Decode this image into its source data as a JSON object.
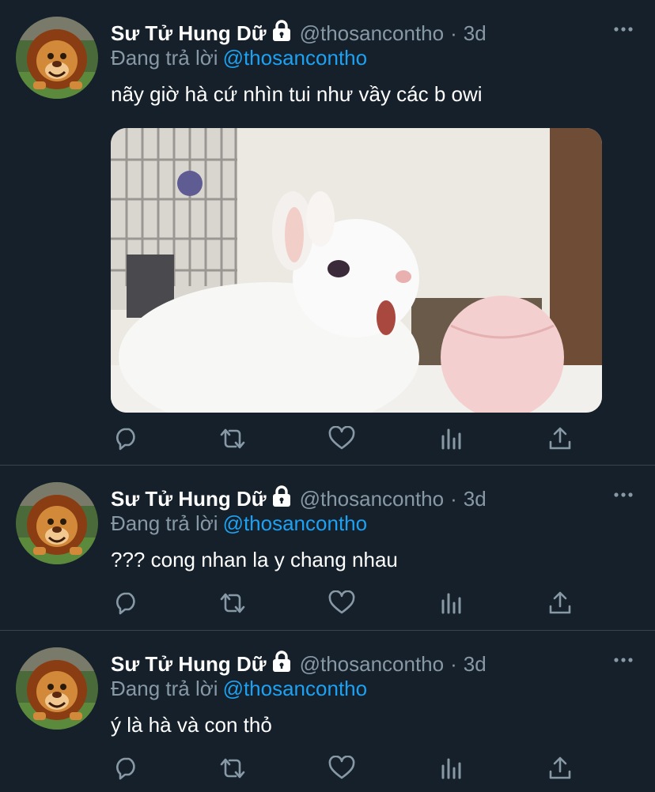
{
  "colors": {
    "background": "#15202b",
    "divider": "#38444d",
    "muted": "#8899a6",
    "accent": "#1da1f2",
    "text": "#ffffff"
  },
  "tweets": [
    {
      "display_name": "Sư Tử Hung Dữ",
      "handle": "@thosancontho",
      "separator": "·",
      "time": "3d",
      "reply_prefix": "Đang trả lời",
      "reply_to": "@thosancontho",
      "text": "nãy giờ hà cứ nhìn tui như vầy các b owi",
      "has_media": true,
      "avatar_icon": "lion-avatar",
      "lock_icon": "lock-icon"
    },
    {
      "display_name": "Sư Tử Hung Dữ",
      "handle": "@thosancontho",
      "separator": "·",
      "time": "3d",
      "reply_prefix": "Đang trả lời",
      "reply_to": "@thosancontho",
      "text": "??? cong nhan la y chang nhau",
      "has_media": false,
      "avatar_icon": "lion-avatar",
      "lock_icon": "lock-icon"
    },
    {
      "display_name": "Sư Tử Hung Dữ",
      "handle": "@thosancontho",
      "separator": "·",
      "time": "3d",
      "reply_prefix": "Đang trả lời",
      "reply_to": "@thosancontho",
      "text": "ý là hà và con thỏ",
      "has_media": false,
      "avatar_icon": "lion-avatar",
      "lock_icon": "lock-icon"
    }
  ],
  "action_icons": [
    "reply-icon",
    "retweet-icon",
    "like-icon",
    "analytics-icon",
    "share-icon"
  ],
  "menu_icon": "more-options-icon"
}
